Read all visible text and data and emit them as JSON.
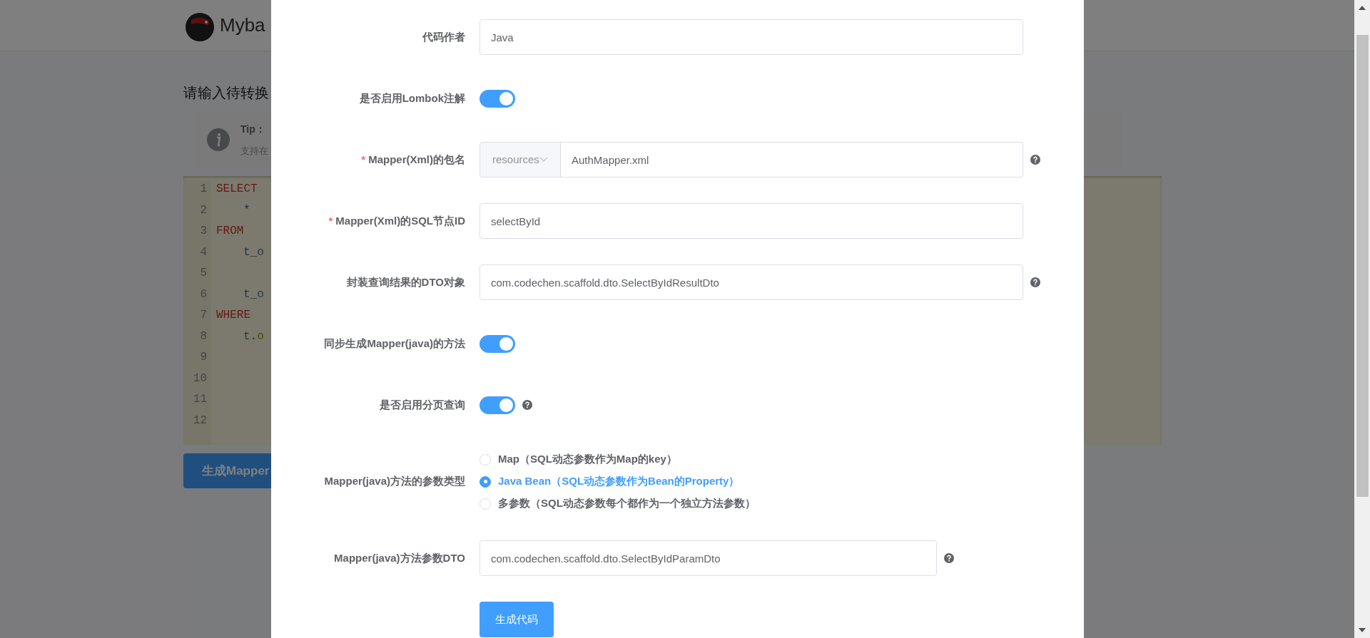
{
  "background_page": {
    "header": {
      "title": "Myba"
    },
    "heading": "请输入待转换",
    "tip": {
      "title": "Tip：",
      "text": "支持在"
    },
    "editor": {
      "lines": [
        {
          "number": "1",
          "indent": false,
          "tokens": [
            {
              "text": "SELECT",
              "kind": "keyword"
            }
          ]
        },
        {
          "number": "2",
          "indent": true,
          "tokens": [
            {
              "text": "*",
              "kind": "symbol"
            }
          ]
        },
        {
          "number": "3",
          "indent": false,
          "tokens": [
            {
              "text": "FROM",
              "kind": "keyword"
            }
          ]
        },
        {
          "number": "4",
          "indent": true,
          "tokens": [
            {
              "text": "t_o",
              "kind": "plain"
            }
          ]
        },
        {
          "number": "5"
        },
        {
          "number": "6",
          "indent": true,
          "tokens": [
            {
              "text": "t_o",
              "kind": "plain"
            }
          ]
        },
        {
          "number": "7",
          "indent": false,
          "tokens": [
            {
              "text": "WHERE",
              "kind": "keyword"
            }
          ]
        },
        {
          "number": "8",
          "indent": true,
          "tokens": [
            {
              "text": "t.",
              "kind": "plain"
            },
            {
              "text": "o",
              "kind": "column"
            }
          ]
        },
        {
          "number": "9"
        },
        {
          "number": "10"
        },
        {
          "number": "11"
        },
        {
          "number": "12"
        }
      ]
    },
    "button": "生成Mapper"
  },
  "dialog": {
    "fields": [
      {
        "kind": "text",
        "label": "代码作者",
        "value": "Java",
        "help": false
      },
      {
        "kind": "switch",
        "label": "是否启用Lombok注解",
        "on": true,
        "help": false
      },
      {
        "kind": "select_text",
        "required_mark": "*",
        "label": "Mapper(Xml)的包名",
        "select": "resources",
        "value": "AuthMapper.xml",
        "help": true
      },
      {
        "kind": "text",
        "required_mark": "*",
        "label": "Mapper(Xml)的SQL节点ID",
        "value": "selectById",
        "help": false
      },
      {
        "kind": "text",
        "label": "封装查询结果的DTO对象",
        "value": "com.codechen.scaffold.dto.SelectByIdResultDto",
        "help": true
      },
      {
        "kind": "switch",
        "label": "同步生成Mapper(java)的方法",
        "on": true,
        "help": false
      },
      {
        "kind": "switch",
        "label": "是否启用分页查询",
        "on": true,
        "help": true
      },
      {
        "kind": "radio",
        "label": "Mapper(java)方法的参数类型",
        "options": [
          {
            "label": "Map（SQL动态参数作为Map的key）",
            "selected": false
          },
          {
            "label": "Java Bean（SQL动态参数作为Bean的Property）",
            "selected": true
          },
          {
            "label": "多参数（SQL动态参数每个都作为一个独立方法参数）",
            "selected": false
          }
        ]
      },
      {
        "kind": "short_text",
        "label": "Mapper(java)方法参数DTO",
        "value": "com.codechen.scaffold.dto.SelectByIdParamDto",
        "help": true
      }
    ],
    "submit": "生成代码"
  }
}
